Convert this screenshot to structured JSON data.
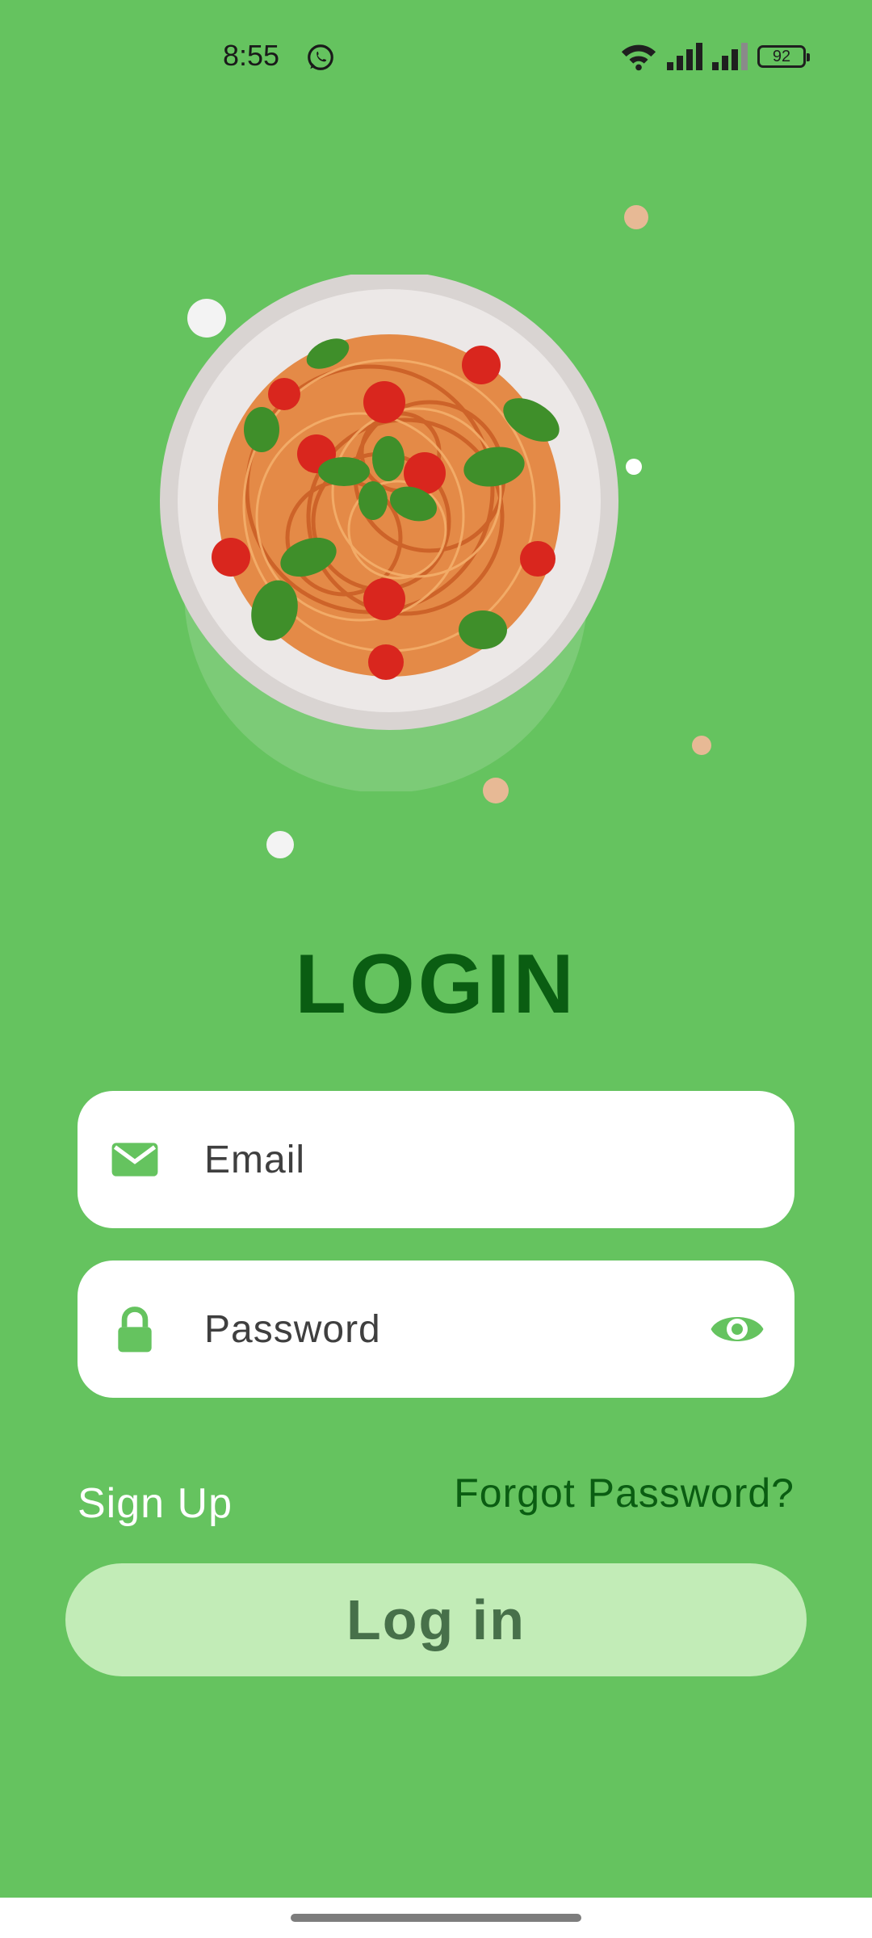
{
  "status_bar": {
    "time": "8:55",
    "battery": "92"
  },
  "login": {
    "title": "LOGIN",
    "email_placeholder": "Email",
    "password_placeholder": "Password",
    "signup_label": "Sign Up",
    "forgot_label": "Forgot Password?",
    "login_button": "Log in"
  },
  "icons": {
    "email": "envelope-icon",
    "password": "lock-icon",
    "visibility": "eye-icon",
    "status": [
      "whatsapp-icon",
      "wifi-icon",
      "signal-icon",
      "battery-icon"
    ]
  },
  "colors": {
    "background": "#65c35f",
    "title": "#0a5d12",
    "accent": "#65c35f",
    "button_bg": "#c2ecb7",
    "button_text": "#47704a"
  }
}
